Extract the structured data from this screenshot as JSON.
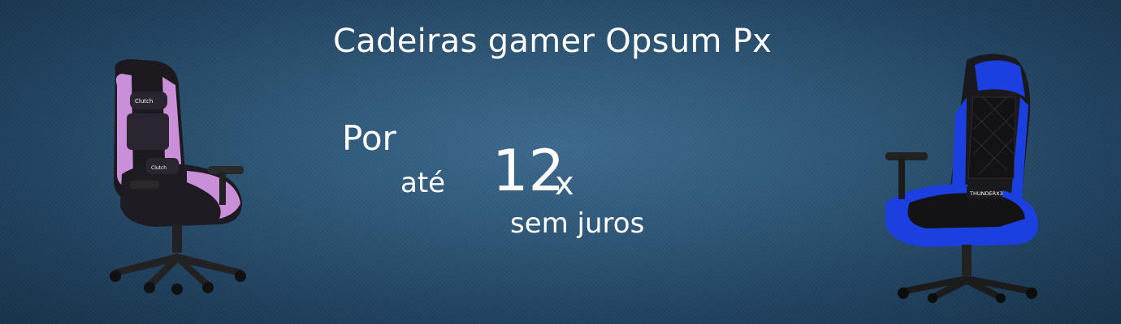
{
  "banner": {
    "headline": "Cadeiras gamer Opsum Px",
    "offer": {
      "por": "Por",
      "ate": "até",
      "installments_number": "12",
      "installments_suffix": "x",
      "interest_text": "sem juros"
    },
    "chairs": [
      {
        "icon": "pink-gaming-chair-icon",
        "accent_color": "#c98fd9",
        "logo_text": "Clutch"
      },
      {
        "icon": "blue-gaming-chair-icon",
        "accent_color": "#1c3fe0",
        "logo_text": "THUNDERX3"
      }
    ]
  },
  "colors": {
    "background": "#2f5878",
    "text": "#ffffff"
  }
}
